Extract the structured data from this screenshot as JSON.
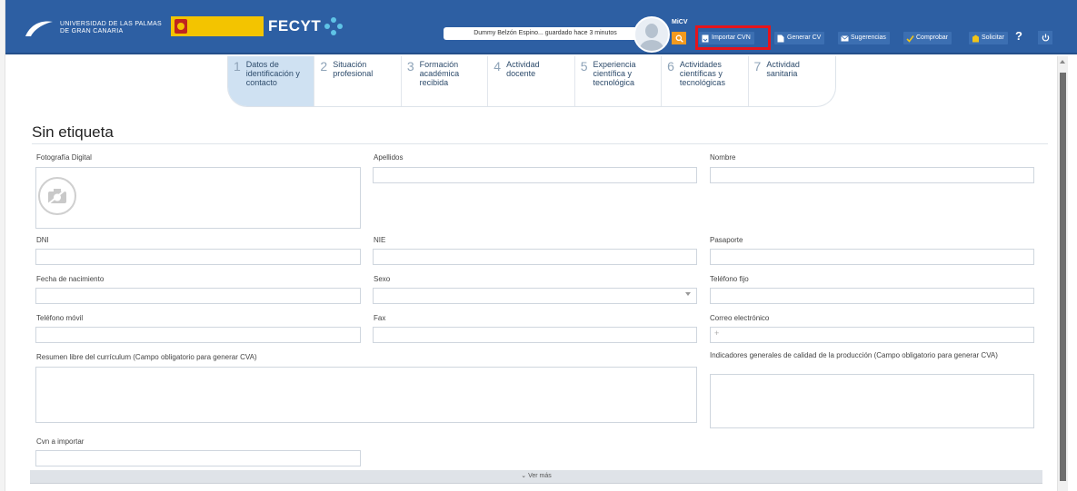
{
  "header": {
    "university_name_line1": "UNIVERSIDAD DE LAS PALMAS",
    "university_name_line2": "DE GRAN CANARIA",
    "fecyt_label": "FECYT",
    "status_text": "Dummy Belzón Espino... guardado hace 3 minutos",
    "user_label": "MiCV",
    "buttons": {
      "importar": "Importar CVN",
      "generar": "Generar CV",
      "sugerencias": "Sugerencias",
      "comprobar": "Comprobar",
      "solicitar": "Solicitar",
      "help": "?"
    }
  },
  "tabs": [
    {
      "num": "1",
      "label": "Datos de identificación y contacto"
    },
    {
      "num": "2",
      "label": "Situación profesional"
    },
    {
      "num": "3",
      "label": "Formación académica recibida"
    },
    {
      "num": "4",
      "label": "Actividad docente"
    },
    {
      "num": "5",
      "label": "Experiencia científica y tecnológica"
    },
    {
      "num": "6",
      "label": "Actividades científicas y tecnológicas"
    },
    {
      "num": "7",
      "label": "Actividad sanitaria"
    }
  ],
  "form": {
    "section_title": "Sin etiqueta",
    "labels": {
      "photo": "Fotografía Digital",
      "apellidos": "Apellidos",
      "nombre": "Nombre",
      "dni": "DNI",
      "nie": "NIE",
      "pasaporte": "Pasaporte",
      "fecha": "Fecha de nacimiento",
      "sexo": "Sexo",
      "telefono_fijo": "Teléfono fijo",
      "telefono_movil": "Teléfono móvil",
      "fax": "Fax",
      "correo": "Correo electrónico",
      "resumen": "Resumen libre del currículum (Campo obligatorio para generar CVA)",
      "indicadores": "Indicadores generales de calidad de la producción (Campo obligatorio para generar CVA)",
      "cvn": "Cvn a importar"
    },
    "email_prefix": "+",
    "ver_mas": "Ver más"
  },
  "colors": {
    "header_bg": "#2d5fa3",
    "highlight": "#e5141c",
    "active_tab": "#cfe1f2",
    "search_orange": "#f29a1e"
  }
}
